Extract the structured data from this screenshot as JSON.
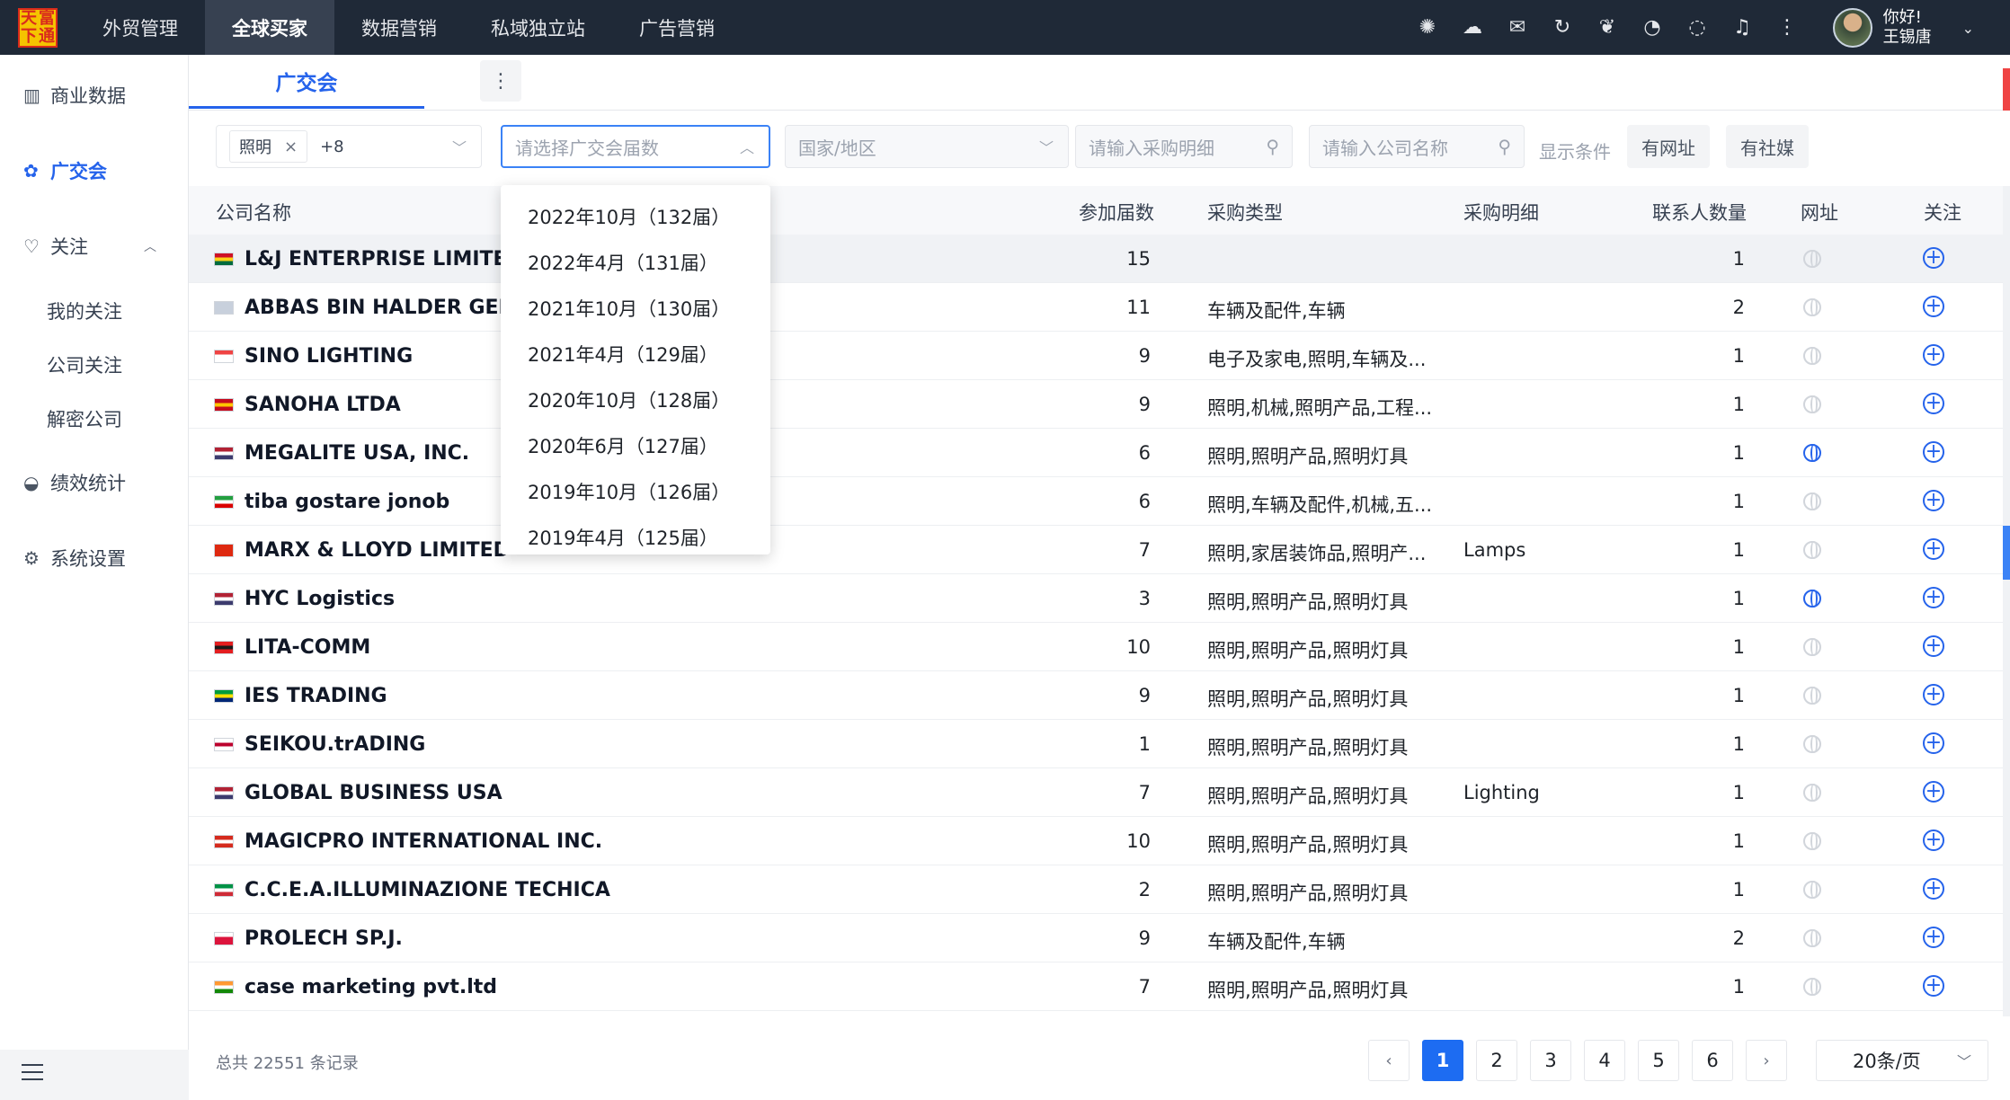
{
  "logo": [
    "天",
    "富",
    "下",
    "通"
  ],
  "topnav": [
    "外贸管理",
    "全球买家",
    "数据营销",
    "私域独立站",
    "广告营销"
  ],
  "user": {
    "greeting": "你好!",
    "name": "王锡唐"
  },
  "top_icons": [
    "openai-icon",
    "cloud-icon",
    "cloud-message-icon",
    "refresh-icon",
    "gift-icon",
    "whatsapp-icon",
    "chat-icon",
    "bell-icon",
    "more-vertical-icon"
  ],
  "sidebar": {
    "commercial": "商业数据",
    "canton": "广交会",
    "follow": "关注",
    "my_follow": "我的关注",
    "company_follow": "公司关注",
    "decrypt": "解密公司",
    "stats": "绩效统计",
    "settings": "系统设置"
  },
  "tab": {
    "label": "广交会"
  },
  "filters": {
    "tag": "照明",
    "more_count": "+8",
    "session_placeholder": "请选择广交会届数",
    "country_placeholder": "国家/地区",
    "purchase_placeholder": "请输入采购明细",
    "company_placeholder": "请输入公司名称",
    "show_label": "显示条件",
    "chip_website": "有网址",
    "chip_social": "有社媒"
  },
  "columns": {
    "name": "公司名称",
    "sessions": "参加届数",
    "type": "采购类型",
    "detail": "采购明细",
    "contacts": "联系人数量",
    "website": "网址",
    "follow": "关注"
  },
  "rows": [
    {
      "name": "L&J ENTERPRISE LIMITED",
      "sessions": "15",
      "type": "",
      "detail": "",
      "contacts": "1",
      "flag": [
        "#ce1126",
        "#fcd116",
        "#006b3f"
      ],
      "web": false
    },
    {
      "name": "ABBAS BIN HALDER GENERAL",
      "sessions": "11",
      "type": "车辆及配件,车辆",
      "detail": "",
      "contacts": "2",
      "flag": [
        "#c8d0dc",
        "#c8d0dc",
        "#c8d0dc"
      ],
      "web": false
    },
    {
      "name": "SINO LIGHTING",
      "sessions": "9",
      "type": "电子及家电,照明,车辆及...",
      "detail": "",
      "contacts": "1",
      "flag": [
        "#ef4444",
        "#ffffff",
        "#ffffff"
      ],
      "web": false
    },
    {
      "name": "SANOHA LTDA",
      "sessions": "9",
      "type": "照明,机械,照明产品,工程...",
      "detail": "",
      "contacts": "1",
      "flag": [
        "#c60b1e",
        "#ffc400",
        "#c60b1e"
      ],
      "web": false
    },
    {
      "name": "MEGALITE USA, INC.",
      "sessions": "6",
      "type": "照明,照明产品,照明灯具",
      "detail": "",
      "contacts": "1",
      "flag": [
        "#b22234",
        "#ffffff",
        "#3c3b6e"
      ],
      "web": true
    },
    {
      "name": "tiba gostare jonob",
      "sessions": "6",
      "type": "照明,车辆及配件,机械,五...",
      "detail": "",
      "contacts": "1",
      "flag": [
        "#239f40",
        "#ffffff",
        "#da0000"
      ],
      "web": false
    },
    {
      "name": "MARX & LLOYD LIMITED",
      "sessions": "7",
      "type": "照明,家居装饰品,照明产...",
      "detail": "Lamps",
      "contacts": "1",
      "flag": [
        "#de2910",
        "#de2910",
        "#de2910"
      ],
      "web": false
    },
    {
      "name": "HYC Logistics",
      "sessions": "3",
      "type": "照明,照明产品,照明灯具",
      "detail": "",
      "contacts": "1",
      "flag": [
        "#b22234",
        "#ffffff",
        "#3c3b6e"
      ],
      "web": true
    },
    {
      "name": "LITA-COMM",
      "sessions": "10",
      "type": "照明,照明产品,照明灯具",
      "detail": "",
      "contacts": "1",
      "flag": [
        "#e41e20",
        "#1a1a1a",
        "#e41e20"
      ],
      "web": false
    },
    {
      "name": "IES TRADING",
      "sessions": "9",
      "type": "照明,照明产品,照明灯具",
      "detail": "",
      "contacts": "1",
      "flag": [
        "#009c3b",
        "#ffdf00",
        "#002776"
      ],
      "web": false
    },
    {
      "name": "SEIKOU.trADING",
      "sessions": "1",
      "type": "照明,照明产品,照明灯具",
      "detail": "",
      "contacts": "1",
      "flag": [
        "#ffffff",
        "#bc002d",
        "#ffffff"
      ],
      "web": false
    },
    {
      "name": "GLOBAL BUSINESS USA",
      "sessions": "7",
      "type": "照明,照明产品,照明灯具",
      "detail": "Lighting",
      "contacts": "1",
      "flag": [
        "#b22234",
        "#ffffff",
        "#3c3b6e"
      ],
      "web": false
    },
    {
      "name": "MAGICPRO INTERNATIONAL INC.",
      "sessions": "10",
      "type": "照明,照明产品,照明灯具",
      "detail": "",
      "contacts": "1",
      "flag": [
        "#d52b1e",
        "#ffffff",
        "#d52b1e"
      ],
      "web": false
    },
    {
      "name": "C.C.E.A.ILLUMINAZIONE TECHICA",
      "sessions": "2",
      "type": "照明,照明产品,照明灯具",
      "detail": "",
      "contacts": "1",
      "flag": [
        "#009246",
        "#ffffff",
        "#ce2b37"
      ],
      "web": false
    },
    {
      "name": "PROLECH SP.J.",
      "sessions": "9",
      "type": "车辆及配件,车辆",
      "detail": "",
      "contacts": "2",
      "flag": [
        "#ffffff",
        "#dc143c",
        "#dc143c"
      ],
      "web": false
    },
    {
      "name": "case marketing pvt.ltd",
      "sessions": "7",
      "type": "照明,照明产品,照明灯具",
      "detail": "",
      "contacts": "1",
      "flag": [
        "#ff9933",
        "#ffffff",
        "#138808"
      ],
      "web": false
    }
  ],
  "dropdown": [
    "2022年10月（132届）",
    "2022年4月（131届）",
    "2021年10月（130届）",
    "2021年4月（129届）",
    "2020年10月（128届）",
    "2020年6月（127届）",
    "2019年10月（126届）",
    "2019年4月（125届）"
  ],
  "footer": {
    "total": "总共 22551 条记录",
    "pages": [
      "1",
      "2",
      "3",
      "4",
      "5",
      "6"
    ],
    "current_page": "1",
    "page_size": "20条/页"
  }
}
